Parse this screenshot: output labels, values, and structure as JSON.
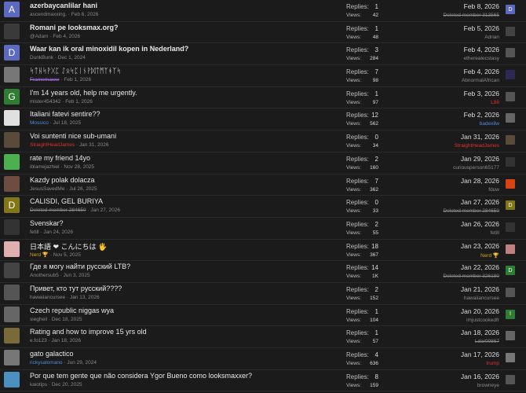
{
  "threads": [
    {
      "title": "azerbaycanlilar hani",
      "bold": true,
      "author": "ascendmaxxing.",
      "author_style": "",
      "date": "Feb 6, 2026",
      "replies": "1",
      "views": "42",
      "last_date": "Feb 8, 2026",
      "last_user": "Deleted member 313565",
      "last_user_style": "strike",
      "avatar_letter": "A",
      "avatar_color": "#5c6bc0",
      "last_avatar_letter": "D",
      "last_avatar_color": "#5c6bc0"
    },
    {
      "title": "Romani pe looksmax.org?",
      "bold": true,
      "author": "@Adam",
      "author_style": "",
      "date": "Feb 4, 2026",
      "replies": "1",
      "views": "48",
      "last_date": "Feb 5, 2026",
      "last_user": "Adrian",
      "last_user_style": "",
      "avatar_letter": "",
      "avatar_color": "#3a3a3a",
      "last_avatar_letter": "",
      "last_avatar_color": "#444"
    },
    {
      "title": "Waar kan ik oral minoxidil kopen in Nederland?",
      "bold": true,
      "author": "DunkBunk",
      "author_style": "",
      "date": "Dec 1, 2024",
      "replies": "3",
      "views": "284",
      "last_date": "Feb 4, 2026",
      "last_user": "etherealecstasy",
      "last_user_style": "",
      "avatar_letter": "D",
      "avatar_color": "#5c6bc0",
      "last_avatar_letter": "",
      "last_avatar_color": "#555"
    },
    {
      "title": "ᛋᛏᚺᛋᚹᚷᛈ ᛇᛟᛋᛈᛁᚾᚹᛞᛏᛗᛉᚼᛉᛋ",
      "bold": false,
      "author": "Framemaxxx",
      "author_style": "purple strike",
      "date": "Feb 1, 2026",
      "replies": "7",
      "views": "98",
      "last_date": "Feb 4, 2026",
      "last_user": "AbnormalAfrican",
      "last_user_style": "",
      "avatar_letter": "",
      "avatar_color": "#777",
      "last_avatar_letter": "",
      "last_avatar_color": "#2a2a55"
    },
    {
      "title": "I'm 14 years old, help me urgently.",
      "bold": false,
      "author": "mister454342",
      "author_style": "",
      "date": "Feb 1, 2026",
      "replies": "1",
      "views": "97",
      "last_date": "Feb 3, 2026",
      "last_user": "L88",
      "last_user_style": "red",
      "avatar_letter": "G",
      "avatar_color": "#2e7d32",
      "last_avatar_letter": "",
      "last_avatar_color": "#555"
    },
    {
      "title": "Italiani fatevi sentire??",
      "bold": false,
      "author": "Mossico",
      "author_style": "blue",
      "date": "Jul 18, 2025",
      "replies": "12",
      "views": "562",
      "last_date": "Feb 2, 2026",
      "last_user": "badexilw",
      "last_user_style": "blue",
      "avatar_letter": "",
      "avatar_color": "#e0e0e0",
      "last_avatar_letter": "",
      "last_avatar_color": "#666"
    },
    {
      "title": "Voi suntenti nice sub-umani",
      "bold": false,
      "author": "StraightHeadJames",
      "author_style": "red",
      "date": "Jan 31, 2026",
      "replies": "0",
      "views": "34",
      "last_date": "Jan 31, 2026",
      "last_user": "StraightHeadJames",
      "last_user_style": "red",
      "avatar_letter": "",
      "avatar_color": "#5a4a3a",
      "last_avatar_letter": "",
      "last_avatar_color": "#5a4a3a"
    },
    {
      "title": "rate my friend 14yo",
      "bold": false,
      "author": "iblamejazhiel",
      "author_style": "",
      "date": "Nov 28, 2025",
      "replies": "2",
      "views": "160",
      "last_date": "Jan 29, 2026",
      "last_user": "curiousperson65177",
      "last_user_style": "",
      "avatar_letter": "",
      "avatar_color": "#4caf50",
      "last_avatar_letter": "",
      "last_avatar_color": "#333"
    },
    {
      "title": "Kazdy polak dolacza",
      "bold": false,
      "author": "JesusSavedMe",
      "author_style": "",
      "date": "Jul 26, 2025",
      "replies": "7",
      "views": "362",
      "last_date": "Jan 28, 2026",
      "last_user": "fduw",
      "last_user_style": "",
      "avatar_letter": "",
      "avatar_color": "#6d4c41",
      "last_avatar_letter": "",
      "last_avatar_color": "#d84315"
    },
    {
      "title": "CALISDI, GEL BURIYA",
      "bold": false,
      "author": "Deleted member 284650",
      "author_style": "strike",
      "date": "Jan 27, 2026",
      "replies": "0",
      "views": "33",
      "last_date": "Jan 27, 2026",
      "last_user": "Deleted member 284650",
      "last_user_style": "strike",
      "avatar_letter": "D",
      "avatar_color": "#827717",
      "last_avatar_letter": "D",
      "last_avatar_color": "#827717"
    },
    {
      "title": "Svenskar?",
      "bold": false,
      "author": "fetill",
      "author_style": "",
      "date": "Jan 24, 2026",
      "replies": "2",
      "views": "55",
      "last_date": "Jan 26, 2026",
      "last_user": "fetill",
      "last_user_style": "",
      "avatar_letter": "",
      "avatar_color": "#333",
      "last_avatar_letter": "",
      "last_avatar_color": "#333"
    },
    {
      "title": "日本語 ❤ こんにちは 🖐",
      "bold": false,
      "author": "Nerd 🏆",
      "author_style": "gold",
      "date": "Nov 5, 2025",
      "replies": "18",
      "views": "367",
      "last_date": "Jan 23, 2026",
      "last_user": "Nerd 🏆",
      "last_user_style": "gold",
      "avatar_letter": "",
      "avatar_color": "#e0b0b0",
      "last_avatar_letter": "",
      "last_avatar_color": "#c08080"
    },
    {
      "title": "Где я могу найти русский LTB?",
      "bold": false,
      "author": "Anothersub5",
      "author_style": "",
      "date": "Jun 3, 2025",
      "replies": "14",
      "views": "1K",
      "last_date": "Jan 22, 2026",
      "last_user": "Deleted member 326180",
      "last_user_style": "strike",
      "avatar_letter": "",
      "avatar_color": "#444",
      "last_avatar_letter": "D",
      "last_avatar_color": "#2e7d32"
    },
    {
      "title": "Привет, кто тут русский????",
      "bold": false,
      "author": "hawaiiancursee",
      "author_style": "",
      "date": "Jan 13, 2026",
      "replies": "2",
      "views": "152",
      "last_date": "Jan 21, 2026",
      "last_user": "hawaiiancursee",
      "last_user_style": "",
      "avatar_letter": "",
      "avatar_color": "#555",
      "last_avatar_letter": "",
      "last_avatar_color": "#555"
    },
    {
      "title": "Czech republic niggas wya",
      "bold": false,
      "author": "siegheil",
      "author_style": "",
      "date": "Dec 18, 2025",
      "replies": "1",
      "views": "104",
      "last_date": "Jan 20, 2026",
      "last_user": "imjustcookedfr",
      "last_user_style": "",
      "avatar_letter": "",
      "avatar_color": "#666",
      "last_avatar_letter": "I",
      "last_avatar_color": "#2e7d32"
    },
    {
      "title": "Rating and how to improve 15 yrs old",
      "bold": false,
      "author": "e.fo123",
      "author_style": "",
      "date": "Jan 18, 2026",
      "replies": "1",
      "views": "57",
      "last_date": "Jan 18, 2026",
      "last_user": "Ldar09867",
      "last_user_style": "strike",
      "avatar_letter": "",
      "avatar_color": "#7a6a3a",
      "last_avatar_letter": "",
      "last_avatar_color": "#666"
    },
    {
      "title": "gato galactico",
      "bold": false,
      "author": "rickysalomano",
      "author_style": "blue",
      "date": "Jun 29, 2024",
      "replies": "4",
      "views": "636",
      "last_date": "Jan 17, 2026",
      "last_user": "trump",
      "last_user_style": "red",
      "avatar_letter": "",
      "avatar_color": "#777",
      "last_avatar_letter": "",
      "last_avatar_color": "#777"
    },
    {
      "title": "Por que tem gente que não considera Ygor Bueno como looksmaxxer?",
      "bold": false,
      "author": "kaiotips",
      "author_style": "",
      "date": "Dec 20, 2025",
      "replies": "8",
      "views": "159",
      "last_date": "Jan 16, 2026",
      "last_user": "browneye",
      "last_user_style": "",
      "avatar_letter": "",
      "avatar_color": "#4a90c0",
      "last_avatar_letter": "",
      "last_avatar_color": "#555"
    }
  ],
  "labels": {
    "replies": "Replies:",
    "views": "Views:"
  }
}
